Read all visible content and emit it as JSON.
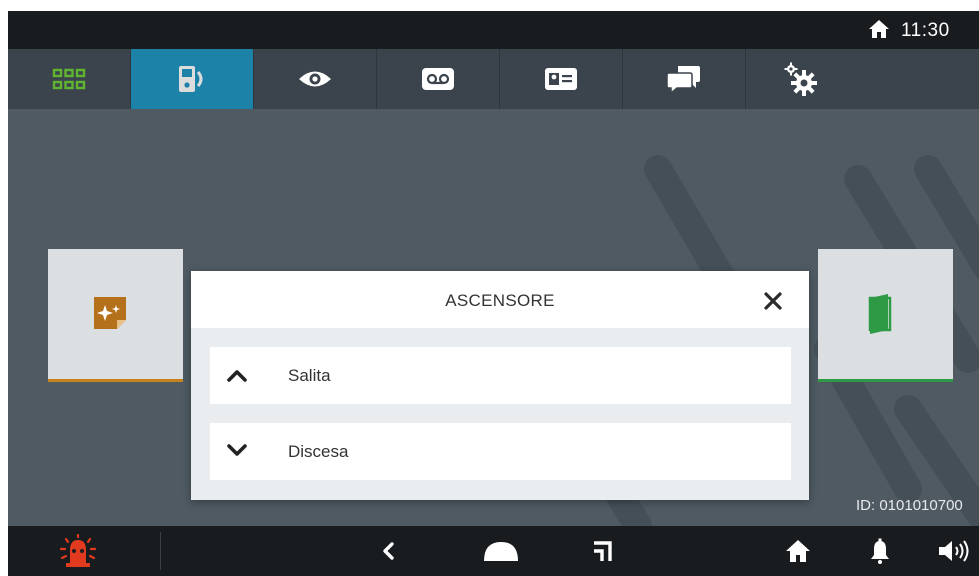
{
  "status_bar": {
    "time": "11:30",
    "home_icon": "home-icon"
  },
  "tabs": [
    {
      "name": "apps",
      "icon": "grid-icon",
      "active": false
    },
    {
      "name": "intercom",
      "icon": "intercom-call-icon",
      "active": true
    },
    {
      "name": "view",
      "icon": "eye-icon",
      "active": false
    },
    {
      "name": "voicemail",
      "icon": "voicemail-icon",
      "active": false
    },
    {
      "name": "contacts",
      "icon": "contact-card-icon",
      "active": false
    },
    {
      "name": "messages",
      "icon": "chat-icon",
      "active": false
    },
    {
      "name": "settings",
      "icon": "gear-icon",
      "active": false
    }
  ],
  "content": {
    "id_label": "ID: 0101010700",
    "left_card_icon": "sparkle-note-icon",
    "right_card_icon": "door-icon"
  },
  "modal": {
    "title": "ASCENSORE",
    "options": [
      {
        "label": "Salita",
        "icon": "chevron-up-icon"
      },
      {
        "label": "Discesa",
        "icon": "chevron-down-icon"
      }
    ]
  },
  "bottom_bar": {
    "items": [
      "alarm-icon",
      "back-icon",
      "home-icon",
      "recents-icon",
      "house-icon",
      "bell-icon",
      "volume-icon"
    ]
  },
  "colors": {
    "active_tab": "#1c82a8",
    "left_card_accent": "#c7821b",
    "right_card_accent": "#2f9a46",
    "alarm": "#e23a1e"
  }
}
